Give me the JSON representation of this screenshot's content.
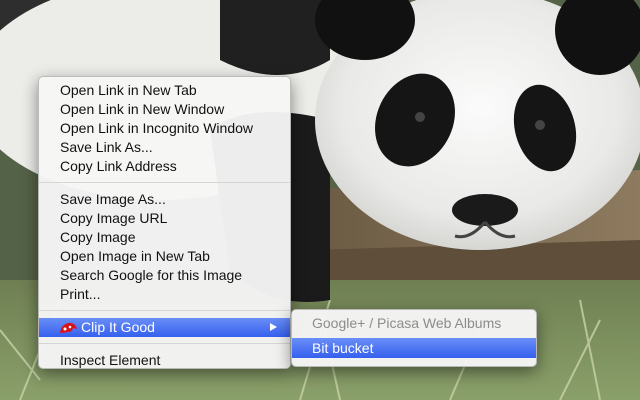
{
  "background": {
    "subject": "giant panda resting on log",
    "accent": "#3560ee"
  },
  "context_menu": {
    "groups": [
      [
        "Open Link in New Tab",
        "Open Link in New Window",
        "Open Link in Incognito Window",
        "Save Link As...",
        "Copy Link Address"
      ],
      [
        "Save Image As...",
        "Copy Image URL",
        "Copy Image",
        "Open Image in New Tab",
        "Search Google for this Image",
        "Print..."
      ]
    ],
    "extension_item": {
      "label": "Clip It Good",
      "icon": "clip-it-good-icon",
      "state": "highlighted"
    },
    "inspect_label": "Inspect Element"
  },
  "submenu": {
    "items": [
      {
        "label": "Google+ / Picasa Web Albums",
        "state": "disabled"
      },
      {
        "label": "Bit bucket",
        "state": "highlighted"
      }
    ]
  }
}
